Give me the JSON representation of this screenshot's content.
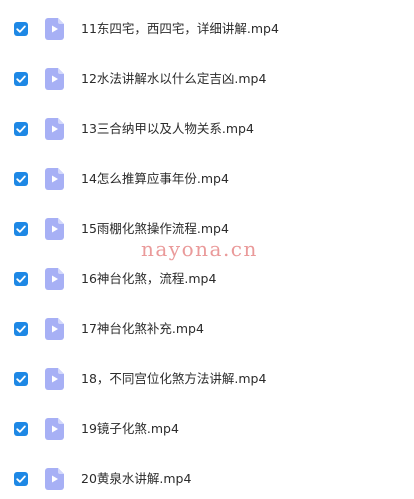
{
  "files": [
    {
      "name": "11东四宅，西四宅，详细讲解.mp4",
      "checked": true,
      "icon": "video-file-icon"
    },
    {
      "name": "12水法讲解水以什么定吉凶.mp4",
      "checked": true,
      "icon": "video-file-icon"
    },
    {
      "name": "13三合纳甲以及人物关系.mp4",
      "checked": true,
      "icon": "video-file-icon"
    },
    {
      "name": "14怎么推算应事年份.mp4",
      "checked": true,
      "icon": "video-file-icon"
    },
    {
      "name": "15雨棚化煞操作流程.mp4",
      "checked": true,
      "icon": "video-file-icon"
    },
    {
      "name": "16神台化煞，流程.mp4",
      "checked": true,
      "icon": "video-file-icon"
    },
    {
      "name": "17神台化煞补充.mp4",
      "checked": true,
      "icon": "video-file-icon"
    },
    {
      "name": "18，不同宫位化煞方法讲解.mp4",
      "checked": true,
      "icon": "video-file-icon"
    },
    {
      "name": "19镜子化煞.mp4",
      "checked": true,
      "icon": "video-file-icon"
    },
    {
      "name": "20黄泉水讲解.mp4",
      "checked": true,
      "icon": "video-file-icon"
    }
  ],
  "watermark": "nayona.cn",
  "colors": {
    "checkbox": "#1e88e5",
    "icon_body": "#a7b0f5",
    "icon_fold": "#d3d8fb",
    "text": "#2b2b2b",
    "watermark": "#ea9a9a"
  }
}
